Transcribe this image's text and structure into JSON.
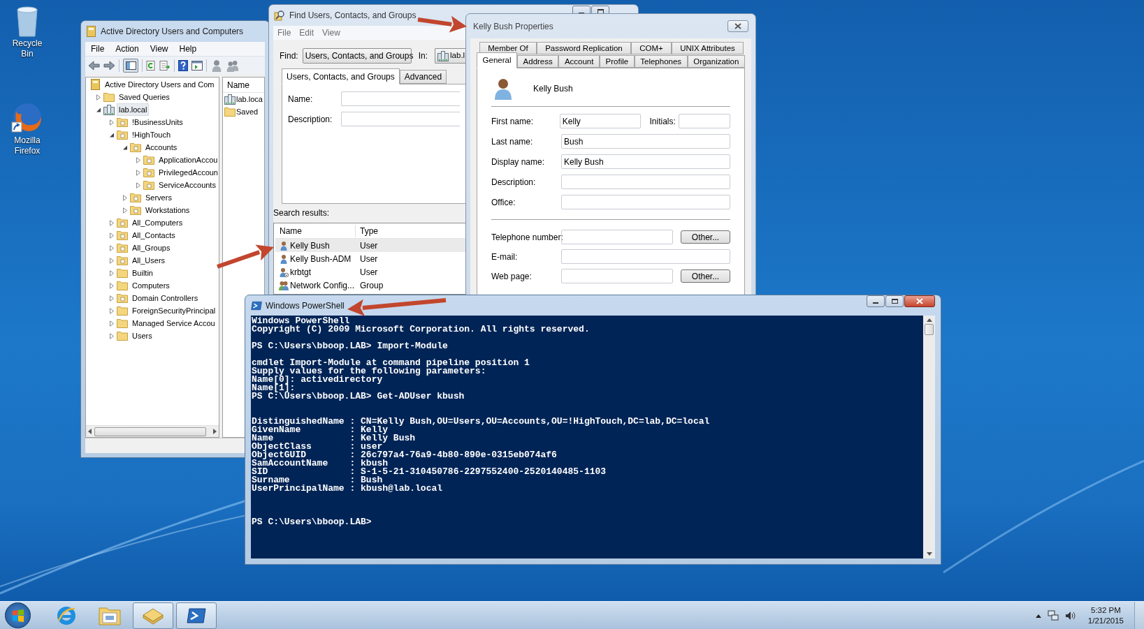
{
  "desktop_icons": [
    {
      "kind": "recycle",
      "label": "Recycle Bin"
    },
    {
      "kind": "browser",
      "label": "Mozilla Firefox"
    }
  ],
  "aduc": {
    "title": "Active Directory Users and Computers",
    "menu": [
      "File",
      "Action",
      "View",
      "Help"
    ],
    "tree": {
      "kind": "root",
      "label": "Active Directory Users and Com",
      "selected": false,
      "children": [
        {
          "kind": "folder",
          "label": "Saved Queries",
          "expanded": false,
          "selected": false
        },
        {
          "kind": "domain",
          "label": "lab.local",
          "expanded": true,
          "selected": true,
          "children": [
            {
              "kind": "ou",
              "label": "!BusinessUnits",
              "expanded": false,
              "selected": false
            },
            {
              "kind": "ou",
              "label": "!HighTouch",
              "expanded": true,
              "selected": false,
              "children": [
                {
                  "kind": "ou",
                  "label": "Accounts",
                  "expanded": true,
                  "selected": false,
                  "children": [
                    {
                      "kind": "ou",
                      "label": "ApplicationAccou",
                      "expanded": false,
                      "selected": false
                    },
                    {
                      "kind": "ou",
                      "label": "PrivilegedAccoun",
                      "expanded": false,
                      "selected": false
                    },
                    {
                      "kind": "ou",
                      "label": "ServiceAccounts",
                      "expanded": false,
                      "selected": false
                    }
                  ]
                },
                {
                  "kind": "ou",
                  "label": "Servers",
                  "expanded": false,
                  "selected": false
                },
                {
                  "kind": "ou",
                  "label": "Workstations",
                  "expanded": false,
                  "selected": false
                }
              ]
            },
            {
              "kind": "ou",
              "label": "All_Computers",
              "expanded": false,
              "selected": false
            },
            {
              "kind": "ou",
              "label": "All_Contacts",
              "expanded": false,
              "selected": false
            },
            {
              "kind": "ou",
              "label": "All_Groups",
              "expanded": false,
              "selected": false
            },
            {
              "kind": "ou",
              "label": "All_Users",
              "expanded": false,
              "selected": false
            },
            {
              "kind": "folder",
              "label": "Builtin",
              "expanded": false,
              "selected": false
            },
            {
              "kind": "folder",
              "label": "Computers",
              "expanded": false,
              "selected": false
            },
            {
              "kind": "ou",
              "label": "Domain Controllers",
              "expanded": false,
              "selected": false
            },
            {
              "kind": "folder",
              "label": "ForeignSecurityPrincipal",
              "expanded": false,
              "selected": false
            },
            {
              "kind": "folder",
              "label": "Managed Service Accou",
              "expanded": false,
              "selected": false
            },
            {
              "kind": "folder",
              "label": "Users",
              "expanded": false,
              "selected": false
            }
          ]
        }
      ]
    },
    "list": {
      "column": "Name",
      "items": [
        {
          "kind": "domain",
          "label": "lab.loca"
        },
        {
          "kind": "folder",
          "label": "Saved"
        }
      ]
    }
  },
  "find": {
    "title": "Find Users, Contacts, and Groups",
    "menu": [
      "File",
      "Edit",
      "View"
    ],
    "find_label": "Find:",
    "find_value": "Users, Contacts, and Groups",
    "in_label": "In:",
    "in_value": "lab.l",
    "tabs": [
      {
        "label": "Users, Contacts, and Groups",
        "selected": true
      },
      {
        "label": "Advanced",
        "selected": false
      }
    ],
    "fields": [
      {
        "label": "Name:"
      },
      {
        "label": "Description:"
      }
    ],
    "results_label": "Search results:",
    "columns": [
      "Name",
      "Type"
    ],
    "rows": [
      {
        "kind": "user",
        "name": "Kelly Bush",
        "type": "User",
        "selected": true
      },
      {
        "kind": "user",
        "name": "Kelly Bush-ADM",
        "type": "User",
        "selected": false
      },
      {
        "kind": "disabled-user",
        "name": "krbtgt",
        "type": "User",
        "selected": false
      },
      {
        "kind": "group",
        "name": "Network Config...",
        "type": "Group",
        "selected": false
      }
    ]
  },
  "properties": {
    "title": "Kelly Bush Properties",
    "tab_rows": [
      [
        {
          "label": "Member Of",
          "selected": false
        },
        {
          "label": "Password Replication",
          "selected": false
        },
        {
          "label": "COM+",
          "selected": false
        },
        {
          "label": "UNIX Attributes",
          "selected": false
        }
      ],
      [
        {
          "label": "General",
          "selected": true
        },
        {
          "label": "Address",
          "selected": false
        },
        {
          "label": "Account",
          "selected": false
        },
        {
          "label": "Profile",
          "selected": false
        },
        {
          "label": "Telephones",
          "selected": false
        },
        {
          "label": "Organization",
          "selected": false
        }
      ]
    ],
    "display_name": "Kelly Bush",
    "fields": [
      {
        "label": "First name:",
        "value": "Kelly",
        "extra_label": "Initials:"
      },
      {
        "label": "Last name:",
        "value": "Bush"
      },
      {
        "label": "Display name:",
        "value": "Kelly Bush"
      },
      {
        "label": "Description:"
      },
      {
        "label": "Office:"
      }
    ],
    "contact_fields": [
      {
        "label": "Telephone number:",
        "button": "Other..."
      },
      {
        "label": "E-mail:"
      },
      {
        "label": "Web page:",
        "button": "Other..."
      }
    ]
  },
  "powershell": {
    "title": "Windows PowerShell",
    "blocks": [
      {
        "kind": "banner",
        "lines": [
          "Windows PowerShell",
          "Copyright (C) 2009 Microsoft Corporation. All rights reserved."
        ]
      },
      {
        "kind": "command",
        "lines": [
          "PS C:\\Users\\bboop.LAB> Import-Module"
        ]
      },
      {
        "kind": "command",
        "lines": [
          "cmdlet Import-Module at command pipeline position 1",
          "Supply values for the following parameters:",
          "Name[0]: activedirectory",
          "Name[1]:",
          "PS C:\\Users\\bboop.LAB> Get-ADUser kbush"
        ]
      },
      {
        "kind": "record",
        "lines": [
          "DistinguishedName : CN=Kelly Bush,OU=Users,OU=Accounts,OU=!HighTouch,DC=lab,DC=local",
          "GivenName         : Kelly",
          "Name              : Kelly Bush",
          "ObjectClass       : user",
          "ObjectGUID        : 26c797a4-76a9-4b80-890e-0315eb074af6",
          "SamAccountName    : kbush",
          "SID               : S-1-5-21-310450786-2297552400-2520140485-1103",
          "Surname           : Bush",
          "UserPrincipalName : kbush@lab.local"
        ]
      },
      {
        "kind": "prompt",
        "lines": [
          "PS C:\\Users\\bboop.LAB>"
        ]
      }
    ]
  },
  "taskbar": {
    "items": [
      {
        "kind": "browser",
        "open": false
      },
      {
        "kind": "explorer",
        "open": false
      },
      {
        "kind": "directory",
        "open": true
      },
      {
        "kind": "terminal",
        "open": true
      }
    ],
    "time": "5:32 PM",
    "date": "1/21/2015"
  }
}
